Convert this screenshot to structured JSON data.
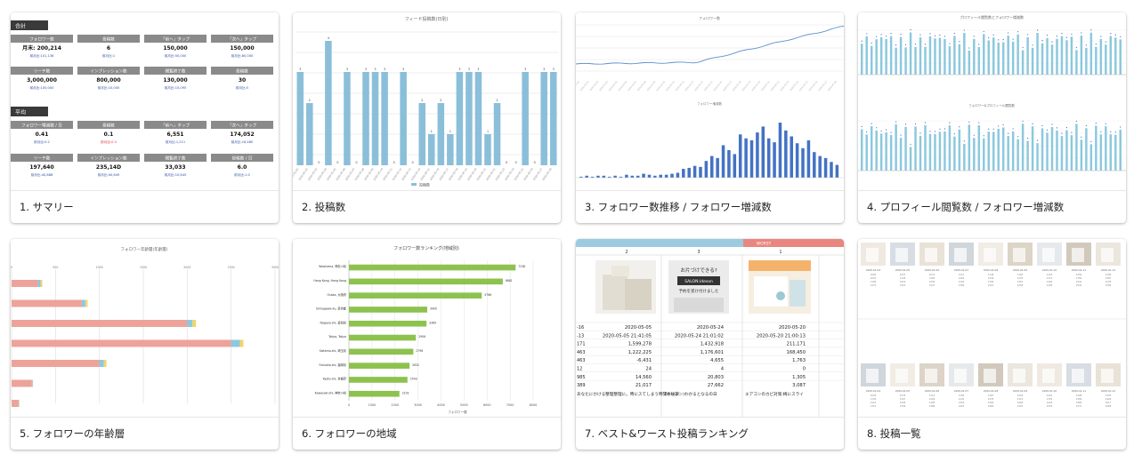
{
  "cards": [
    {
      "label": "1. サマリー"
    },
    {
      "label": "2. 投稿数"
    },
    {
      "label": "3. フォロワー数推移 / フォロワー増減数"
    },
    {
      "label": "4. プロフィール閲覧数 / フォロワー増減数"
    },
    {
      "label": "5. フォロワーの年齢層"
    },
    {
      "label": "6. フォロワーの地域"
    },
    {
      "label": "7. ベスト&ワースト投稿ランキング"
    },
    {
      "label": "8. 投稿一覧"
    }
  ],
  "summary": {
    "section1": "合計",
    "section2": "平均",
    "headers1": [
      "フォロワー数",
      "投稿数",
      "「前へ」タップ",
      "「次へ」タップ"
    ],
    "values1": [
      "月末: 200,214",
      "6",
      "150,000",
      "150,000"
    ],
    "sub1": [
      "前月比:101,136",
      "前月比:1",
      "前月比:50,000",
      "前月比:80,000"
    ],
    "headers2": [
      "リーチ数",
      "インプレッション数",
      "閲覧終了数",
      "投稿数"
    ],
    "values2": [
      "3,000,000",
      "800,000",
      "130,000",
      "30"
    ],
    "sub2": [
      "前月比:100,000",
      "前月比:10,000",
      "前月比:15,095",
      "前月比:5"
    ],
    "headers3": [
      "フォロワー増減数 / 日",
      "投稿数",
      "「前へ」タップ",
      "「次へ」タップ"
    ],
    "values3": [
      "0.41",
      "0.1",
      "6,551",
      "174,052"
    ],
    "sub3": [
      "前月比:0.2",
      "前月比:0.3",
      "前月比:1,211",
      "前月比:16,480"
    ],
    "headers4": [
      "リーチ数",
      "インプレッション数",
      "閲覧終了数",
      "投稿数 / 日"
    ],
    "values4": [
      "197,640",
      "235,14D",
      "33,033",
      "6.0"
    ],
    "sub4": [
      "前月比:40,888",
      "前月比:40,649",
      "前月比:10,645",
      "前月比:1.0"
    ]
  },
  "chart2": {
    "title": "フィード投稿数(日別)",
    "legend": "投稿数"
  },
  "chart3": {
    "title": "フォロワー数",
    "subtitle": "フォロワー増減数"
  },
  "chart4": {
    "title": "プロフィール閲覧数とフォロワー増減数",
    "subtitle": "フォロワー&プロフィール閲覧数"
  },
  "chart5": {
    "title": "フォロワー年齢層(年齢層)",
    "ticks": [
      "0",
      "500",
      "1000",
      "1500",
      "2000",
      "2500",
      "3000"
    ]
  },
  "chart_data": {
    "type": "bar",
    "title": "フォロワー数ランキング(地域別)",
    "xlabel": "フォロワー数",
    "categories": [
      "Yokohama, 神奈川県",
      "Hong Kong, Hong Kong",
      "Osaka, 大阪府",
      "Shinagawa-ku, 東京都",
      "Nagoya-shi, 愛知県",
      "Tokyo, Tokyo",
      "Saitama-shi, 埼玉県",
      "Fukuoka-shi, 福岡県",
      "Kyoto-shi, 京都府",
      "Kawasaki-shi, 神奈川県"
    ],
    "values": [
      7238,
      6681,
      5766,
      3400,
      3369,
      2906,
      2796,
      2632,
      2543,
      2192
    ],
    "xlim": [
      0,
      8000
    ],
    "xticks": [
      "0",
      "1000",
      "2000",
      "3000",
      "4000",
      "5000",
      "6000",
      "7000",
      "8000"
    ]
  },
  "ranking": {
    "col1": "2",
    "col2": "3",
    "worst_tag": "WORST",
    "col3": "1",
    "dates": [
      "2020-05-05",
      "2020-05-24",
      "2020-05-20"
    ],
    "times": [
      "2020-05-05 21:41:05",
      "2020-05-24 21:01:02",
      "2020-05-20 21:00:13"
    ],
    "rowlabels": [
      "-16",
      "-13",
      "171",
      "463",
      "463",
      "12",
      "985",
      "389"
    ],
    "r1": [
      "1,599,278",
      "1,432,918",
      "211,171"
    ],
    "r2": [
      "1,222,225",
      "1,176,601",
      "168,450"
    ],
    "r3": [
      "-6,431",
      "4,655",
      "1,763"
    ],
    "r4": [
      "24",
      "4",
      "0"
    ],
    "r5": [
      "14,560",
      "20,803",
      "1,305"
    ],
    "r6": [
      "21,017",
      "27,662",
      "3,087"
    ],
    "caption1": "あなたにかける整理整理に。時にスてしまう時間の秘訣",
    "caption2": "(キッチン)わかるとなるの日 ",
    "caption3": "エアコンのカビ対策:梅にスライ",
    "box_text": "お片づけできる?\nSALON:ideson\n予約を受け付けました"
  },
  "list": {
    "dates": [
      "2020-01-04",
      "2020-01-05",
      "2020-01-06",
      "2020-01-07",
      "2020-01-08",
      "2020-01-09",
      "2020-01-10",
      "2020-01-11",
      "2020-01-12"
    ]
  }
}
